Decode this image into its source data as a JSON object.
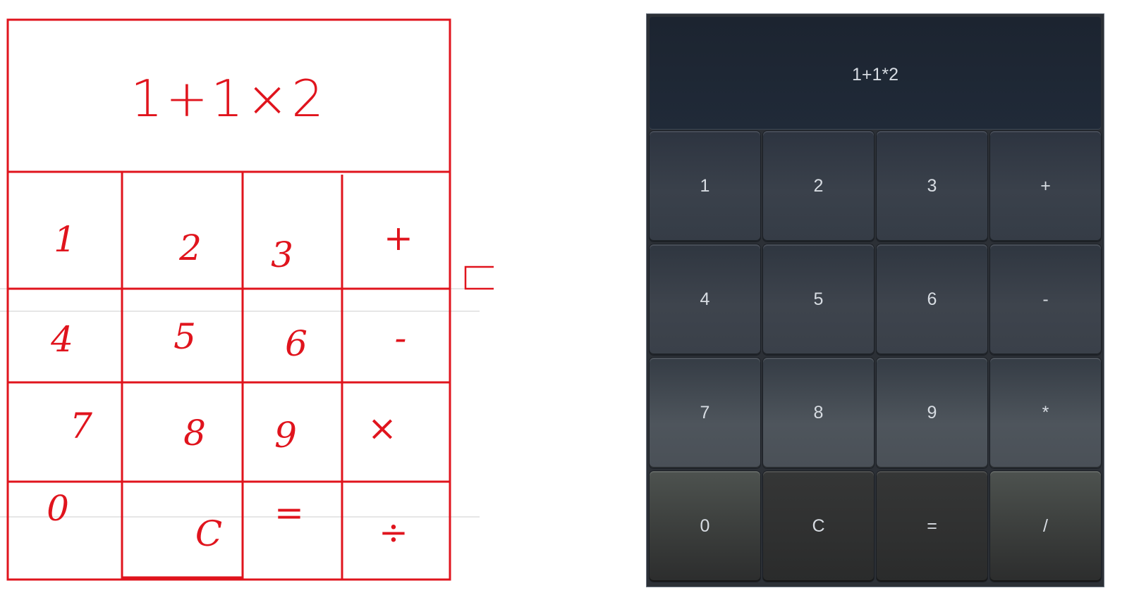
{
  "sketch": {
    "display": "1+1×2",
    "keys": [
      [
        "1",
        "2",
        "3",
        "+"
      ],
      [
        "4",
        "5",
        "6",
        "-"
      ],
      [
        "7",
        "8",
        "9",
        "×"
      ],
      [
        "0",
        "C",
        "=",
        "÷"
      ]
    ]
  },
  "calculator": {
    "display": "1+1*2",
    "keys": [
      [
        "1",
        "2",
        "3",
        "+"
      ],
      [
        "4",
        "5",
        "6",
        "-"
      ],
      [
        "7",
        "8",
        "9",
        "*"
      ],
      [
        "0",
        "C",
        "=",
        "/"
      ]
    ]
  },
  "colors": {
    "sketch_ink": "#e0141d",
    "calc_text": "#d7dce2"
  }
}
